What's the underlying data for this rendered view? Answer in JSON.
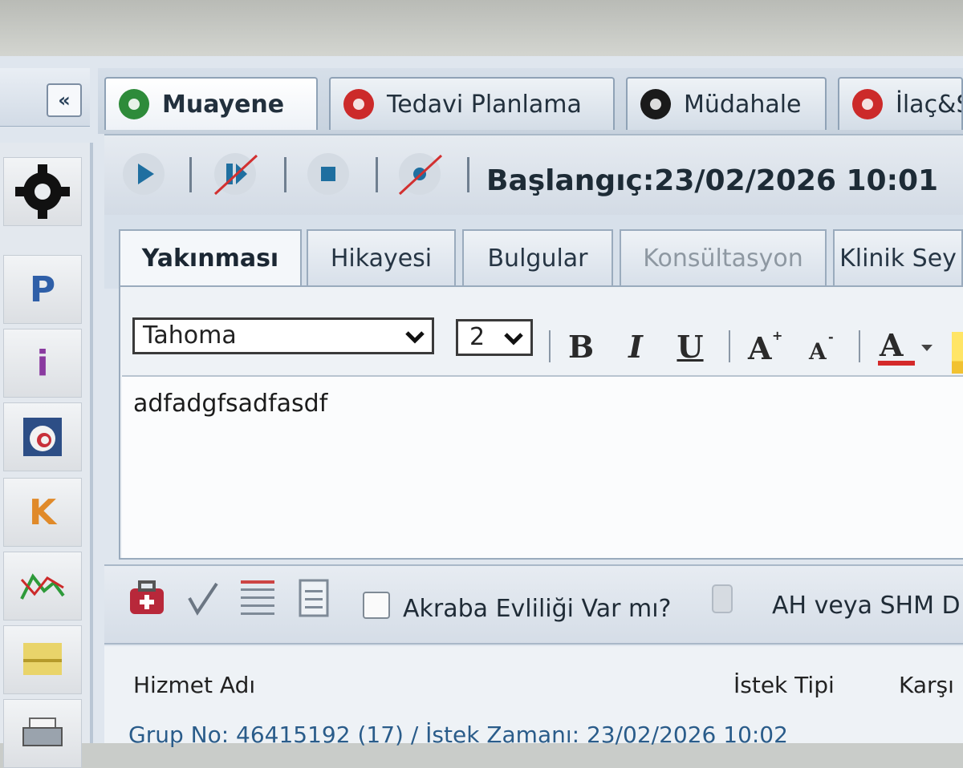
{
  "left_panel": {
    "collapse_glyph": "«",
    "buttons": [
      {
        "icon": "gear-icon"
      },
      {
        "letter": "P",
        "color": "#2f5fa8"
      },
      {
        "letter": "i",
        "color": "#8a3aa0"
      },
      {
        "icon": "e-document-icon"
      },
      {
        "letter": "K",
        "color": "#e08a2a"
      },
      {
        "icon": "chart-line-icon"
      },
      {
        "icon": "note-icon"
      },
      {
        "icon": "printer-icon"
      }
    ]
  },
  "tabs": [
    {
      "label": "Muayene",
      "icon_color": "#2e8b3a",
      "active": true
    },
    {
      "label": "Tedavi Planlama",
      "icon_color": "#cc2a2a",
      "active": false
    },
    {
      "label": "Müdahale",
      "icon_color": "#1a1a1a",
      "active": false
    },
    {
      "label": "İlaç&S",
      "icon_color": "#cc2a2a",
      "active": false
    }
  ],
  "media_toolbar": {
    "start_label": "Başlangıç:",
    "start_value": "23/02/2026 10:01"
  },
  "sub_tabs": [
    {
      "label": "Yakınması",
      "state": "active"
    },
    {
      "label": "Hikayesi",
      "state": "normal"
    },
    {
      "label": "Bulgular",
      "state": "normal"
    },
    {
      "label": "Konsültasyon",
      "state": "disabled"
    },
    {
      "label": "Klinik Sey",
      "state": "normal"
    }
  ],
  "editor": {
    "font_family_value": "Tahoma",
    "font_size_value": "2",
    "content": "adfadgfsadfasdf",
    "font_color": "#d42a2a"
  },
  "bottom_toolbar": {
    "checkbox_label": "Akraba Evliliği Var mı?",
    "checkbox_checked": false,
    "ah_label": "AH veya SHM D"
  },
  "grid": {
    "columns": [
      "Hizmet Adı",
      "İstek Tipi",
      "Karşı"
    ],
    "group_row": "Grup No: 46415192 (17) / İstek Zamanı: 23/02/2026 10:02"
  }
}
